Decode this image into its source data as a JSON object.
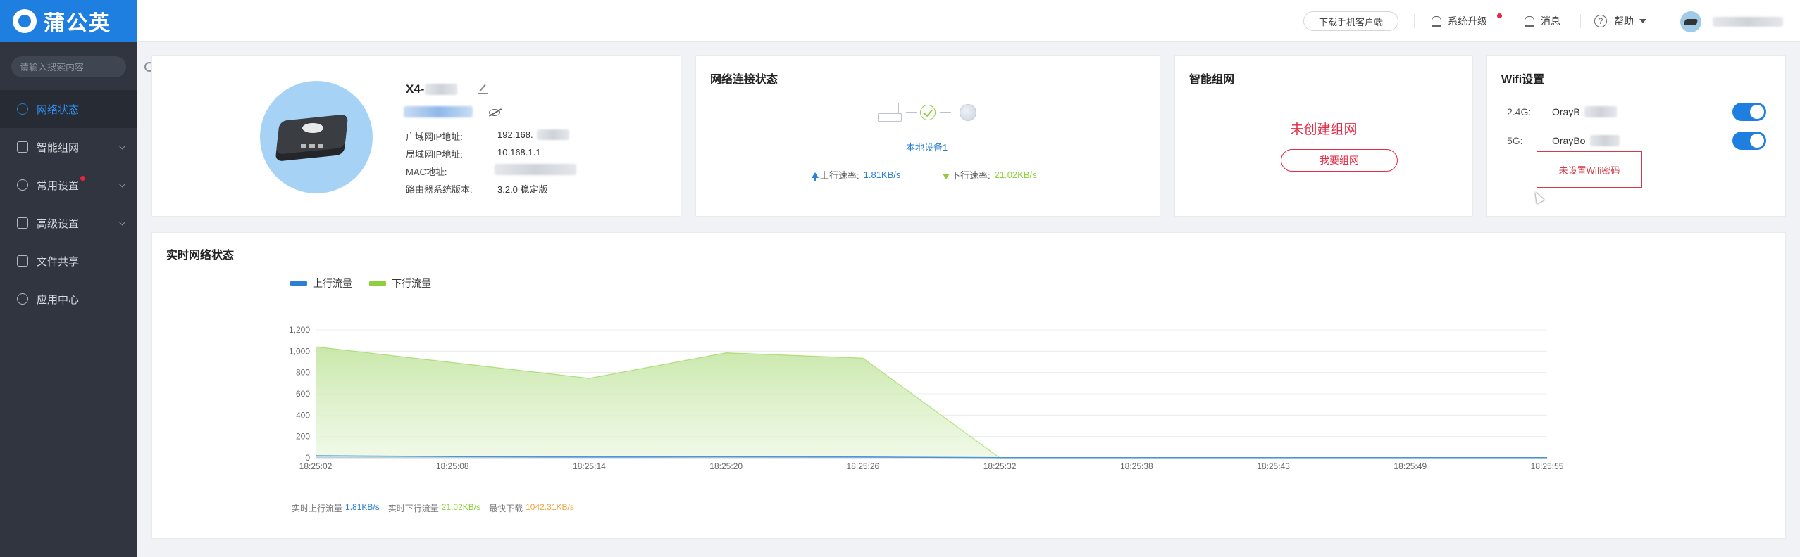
{
  "brand": {
    "name": "蒲公英"
  },
  "sidebar": {
    "search_placeholder": "请输入搜索内容",
    "items": [
      {
        "label": "网络状态",
        "active": true
      },
      {
        "label": "智能组网",
        "expandable": true
      },
      {
        "label": "常用设置",
        "expandable": true,
        "badge": true
      },
      {
        "label": "高级设置",
        "expandable": true
      },
      {
        "label": "文件共享"
      },
      {
        "label": "应用中心"
      }
    ]
  },
  "topbar": {
    "download_label": "下载手机客户端",
    "upgrade_label": "系统升级",
    "message_label": "消息",
    "help_label": "帮助"
  },
  "device": {
    "name": "X4-",
    "wan_ip_label": "广域网IP地址:",
    "wan_ip_value": "192.168.",
    "lan_ip_label": "局域网IP地址:",
    "lan_ip_value": "10.168.1.1",
    "mac_label": "MAC地址:",
    "mac_value": "",
    "firmware_label": "路由器系统版本:",
    "firmware_value": "3.2.0 稳定版"
  },
  "network_status": {
    "title": "网络连接状态",
    "local_device": "本地设备1",
    "up_label": "上行速率:",
    "up_value": "1.81KB/s",
    "down_label": "下行速率:",
    "down_value": "21.02KB/s"
  },
  "mesh": {
    "title": "智能组网",
    "status": "未创建组网",
    "button_label": "我要组网"
  },
  "wifi": {
    "title": "Wifi设置",
    "bands": [
      {
        "label": "2.4G:",
        "ssid": "OrayB",
        "enabled": true
      },
      {
        "label": "5G:",
        "ssid": "OrayBo",
        "enabled": true
      }
    ],
    "tooltip": "未设置Wifi密码"
  },
  "realtime": {
    "title": "实时网络状态",
    "stats": {
      "up_label": "实时上行流量",
      "up_value": "1.81KB/s",
      "down_label": "实时下行流量",
      "down_value": "21.02KB/s",
      "peak_label": "最快下载",
      "peak_value": "1042.31KB/s"
    }
  },
  "colors": {
    "accent": "#1f7fe0",
    "upload": "#2b7fd4",
    "download": "#8dcf3f",
    "alert": "#e02c46",
    "peak": "#f0a540"
  },
  "chart_data": {
    "type": "area",
    "x": [
      "18:25:02",
      "18:25:08",
      "18:25:14",
      "18:25:20",
      "18:25:26",
      "18:25:32",
      "18:25:38",
      "18:25:43",
      "18:25:49",
      "18:25:55"
    ],
    "series": [
      {
        "name": "上行流量",
        "x_index": [
          0,
          1,
          2,
          3,
          4,
          5,
          6,
          7,
          8,
          9
        ],
        "values": [
          20,
          12,
          8,
          10,
          8,
          2,
          2,
          2,
          2,
          2
        ]
      },
      {
        "name": "下行流量",
        "x_index": [
          0,
          2,
          3,
          4,
          5,
          6,
          7,
          8,
          9
        ],
        "values": [
          1042,
          745,
          985,
          935,
          0,
          0,
          0,
          0,
          0
        ]
      }
    ],
    "ylim": [
      0,
      1200
    ],
    "yticks": [
      "0",
      "200",
      "400",
      "600",
      "800",
      "1,000",
      "1,200"
    ],
    "grid": true,
    "legend": "top-left"
  }
}
